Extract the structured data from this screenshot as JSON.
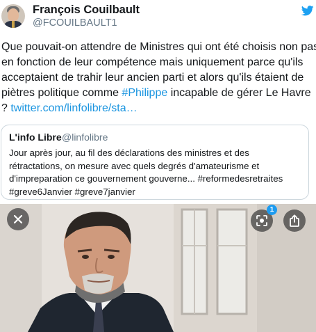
{
  "author": {
    "name": "François Couilbault",
    "handle": "@FCOUILBAULT1",
    "avatar": "avatar"
  },
  "brand": {
    "icon": "twitter-bird-icon",
    "color": "#1da1f2"
  },
  "tweet": {
    "line1": "Que pouvait-on attendre de Ministres qui ont été choisis non pas",
    "line2": "en fonction de leur compétence mais uniquement parce qu'ils",
    "line3": "acceptaient de trahir leur ancien parti et alors qu'ils étaient de",
    "line4_before": "piètres politique comme ",
    "hashtag": "#Philippe",
    "line4_after": " incapable de gérer Le Havre",
    "line5_prefix": "? ",
    "link": "twitter.com/linfolibre/sta…"
  },
  "quote": {
    "name": "L'info Libre",
    "handle": "@linfolibre",
    "line1": "Jour après jour, au fil des déclarations des ministres et des",
    "line2": "rétractations, on mesure avec quels degrés d'amateurisme et",
    "line3": "d'impreparation ce gouvernement gouverne... #reformedesretraites",
    "line4": "#greve6Janvier #greve7janvier"
  },
  "media": {
    "badge_count": "1",
    "icons": [
      "close-icon",
      "lens-icon",
      "share-icon"
    ]
  },
  "colors": {
    "link": "#1b95e0",
    "secondary": "#657786",
    "border": "#ccd6dd"
  }
}
